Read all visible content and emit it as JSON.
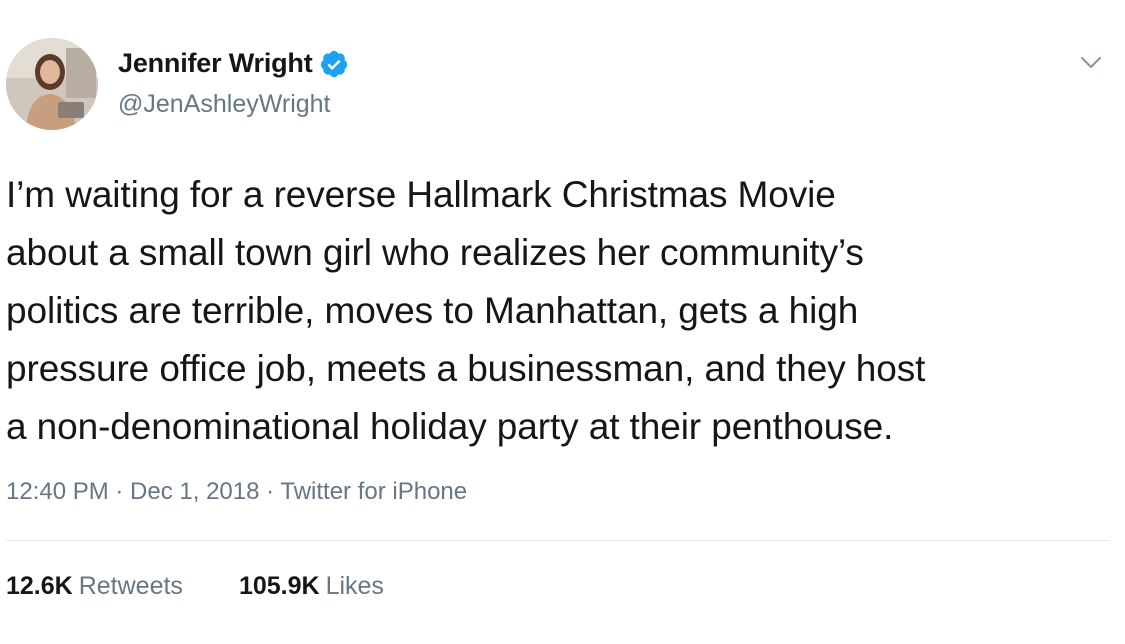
{
  "author": {
    "display_name": "Jennifer Wright",
    "handle": "@JenAshleyWright",
    "verified": true,
    "verified_color": "#1da1f2"
  },
  "icons": {
    "avatar": "avatar-photo",
    "verified": "verified-badge-icon",
    "more": "chevron-down-icon"
  },
  "tweet": {
    "lines": [
      "I’m waiting for a reverse Hallmark Christmas Movie",
      "about a small town girl who realizes her community’s",
      "politics are terrible, moves to Manhattan, gets a high",
      "pressure office job, meets a businessman, and they host",
      "a non-denominational holiday party at their penthouse."
    ]
  },
  "meta": {
    "text": "12:40 PM · Dec 1, 2018 · Twitter for iPhone"
  },
  "stats": {
    "retweets_count": "12.6K",
    "retweets_label": "Retweets",
    "likes_count": "105.9K",
    "likes_label": "Likes"
  }
}
